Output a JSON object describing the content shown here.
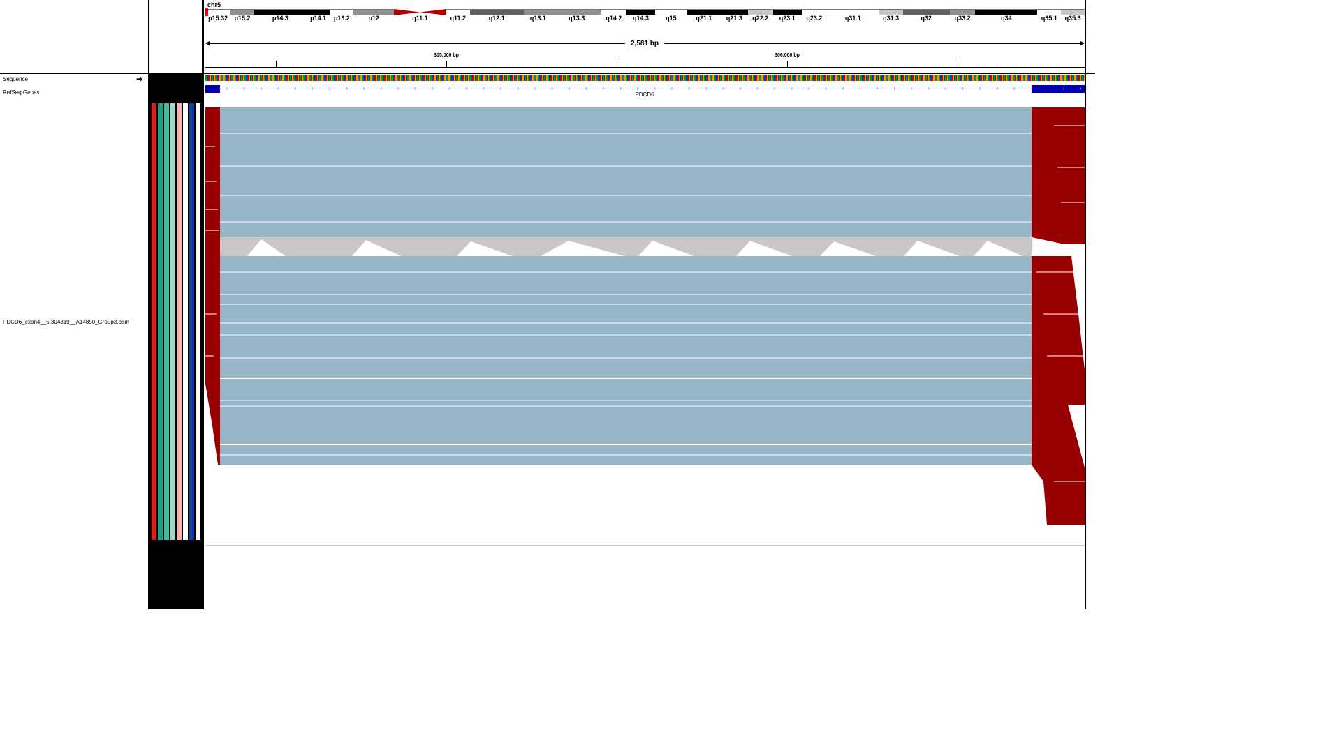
{
  "locus": {
    "chromosome": "chr5",
    "span_label": "2,581 bp"
  },
  "ideogram": {
    "bands": [
      {
        "label": "p15.32",
        "stain": "gneg"
      },
      {
        "label": "p15.2",
        "stain": "gpos50"
      },
      {
        "label": "p14.3",
        "stain": "gpos100"
      },
      {
        "label": "p14.1",
        "stain": "gpos100"
      },
      {
        "label": "p13.2",
        "stain": "gneg"
      },
      {
        "label": "p12",
        "stain": "gpos50"
      },
      {
        "label": "q11.1",
        "stain": "acen"
      },
      {
        "label": "q11.2",
        "stain": "gneg"
      },
      {
        "label": "q12.1",
        "stain": "gpos75"
      },
      {
        "label": "q13.1",
        "stain": "gpos50"
      },
      {
        "label": "q13.3",
        "stain": "gpos50"
      },
      {
        "label": "q14.2",
        "stain": "gneg"
      },
      {
        "label": "q14.3",
        "stain": "gpos100"
      },
      {
        "label": "q15",
        "stain": "gneg"
      },
      {
        "label": "q21.1",
        "stain": "gpos100"
      },
      {
        "label": "q21.3",
        "stain": "gpos100"
      },
      {
        "label": "q22.2",
        "stain": "gpos25"
      },
      {
        "label": "q23.1",
        "stain": "gpos100"
      },
      {
        "label": "q23.2",
        "stain": "gneg"
      },
      {
        "label": "q31.1",
        "stain": "gneg"
      },
      {
        "label": "q31.3",
        "stain": "gpos25"
      },
      {
        "label": "q32",
        "stain": "gpos75"
      },
      {
        "label": "q33.2",
        "stain": "gpos50"
      },
      {
        "label": "q34",
        "stain": "gpos100"
      },
      {
        "label": "q35.1",
        "stain": "gneg"
      },
      {
        "label": "q35.3",
        "stain": "gpos25"
      }
    ]
  },
  "ruler": {
    "tick_labels": [
      "305,000 bp",
      "306,000 bp"
    ]
  },
  "tracks": {
    "sequence": {
      "name": "Sequence",
      "strand_icon": "arrow-right-icon"
    },
    "genes": {
      "name": "RefSeq Genes",
      "gene_label": "PDCD6"
    },
    "alignment": {
      "name": "PDCD6_exon4__5:304319__A14850_Group3.bam"
    }
  },
  "attributes": {
    "colors": [
      "#e02020",
      "#20a080",
      "#40c0a0",
      "#a0d8c8",
      "#ffb0b0",
      "#ffffff",
      "#1040a0",
      "#ffffff"
    ]
  },
  "colors": {
    "alignment": "#97b6c8",
    "mismatch_clip": "#960000",
    "low_mapq": "#c8c8c8",
    "gene": "#0000b0"
  }
}
